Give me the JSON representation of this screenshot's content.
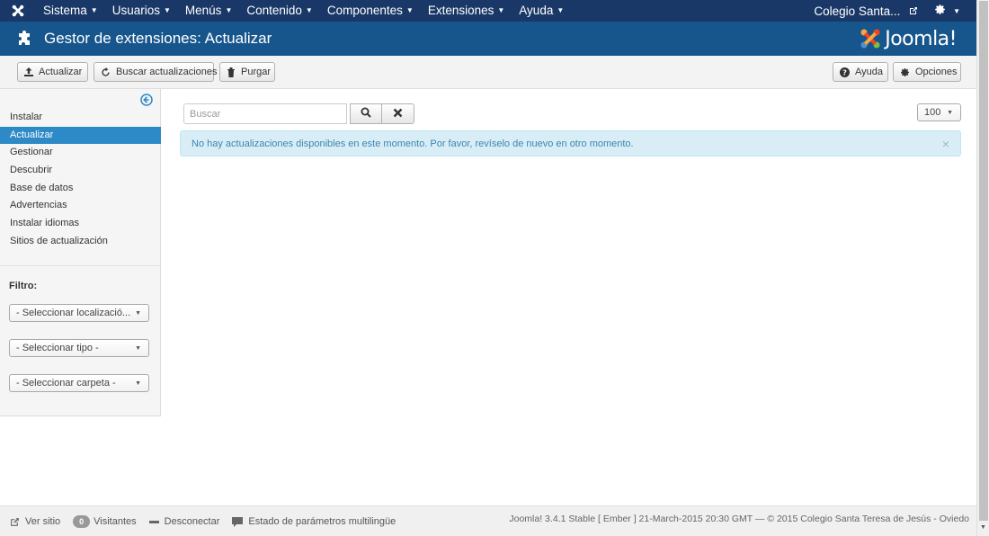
{
  "navbar": {
    "logo_icon": "joomla-icon",
    "menu": [
      {
        "label": "Sistema"
      },
      {
        "label": "Usuarios"
      },
      {
        "label": "Menús"
      },
      {
        "label": "Contenido"
      },
      {
        "label": "Componentes"
      },
      {
        "label": "Extensiones"
      },
      {
        "label": "Ayuda"
      }
    ],
    "site_label": "Colegio Santa...",
    "settings_icon": "gear-icon"
  },
  "header": {
    "title": "Gestor de extensiones: Actualizar",
    "icon": "puzzle-icon",
    "brand": "Joomla!"
  },
  "toolbar": {
    "update_label": "Actualizar",
    "find_updates_label": "Buscar actualizaciones",
    "purge_label": "Purgar",
    "help_label": "Ayuda",
    "options_label": "Opciones"
  },
  "sidebar": {
    "items": [
      {
        "label": "Instalar"
      },
      {
        "label": "Actualizar"
      },
      {
        "label": "Gestionar"
      },
      {
        "label": "Descubrir"
      },
      {
        "label": "Base de datos"
      },
      {
        "label": "Advertencias"
      },
      {
        "label": "Instalar idiomas"
      },
      {
        "label": "Sitios de actualización"
      }
    ],
    "active_index": 1,
    "filter_label": "Filtro:",
    "filters": [
      {
        "value": "- Seleccionar localizació..."
      },
      {
        "value": "- Seleccionar tipo -"
      },
      {
        "value": "- Seleccionar carpeta -"
      }
    ]
  },
  "main": {
    "search_placeholder": "Buscar",
    "limit_value": "100",
    "alert_message": "No hay actualizaciones disponibles en este momento. Por favor, revíselo de nuevo en otro momento."
  },
  "footer": {
    "view_site": "Ver sitio",
    "visitors_count": "0",
    "visitors_label": "Visitantes",
    "logout": "Desconectar",
    "multilang_status": "Estado de parámetros multilingüe",
    "copyright": "Joomla! 3.4.1 Stable [ Ember ] 21-March-2015 20:30 GMT  —  © 2015 Colegio Santa Teresa de Jesús - Oviedo"
  },
  "colors": {
    "navbar_bg": "#1a3867",
    "header_bg": "#17568c",
    "active_item": "#2d8ac7",
    "alert_bg": "#d9edf7",
    "alert_text": "#3a87ad"
  }
}
